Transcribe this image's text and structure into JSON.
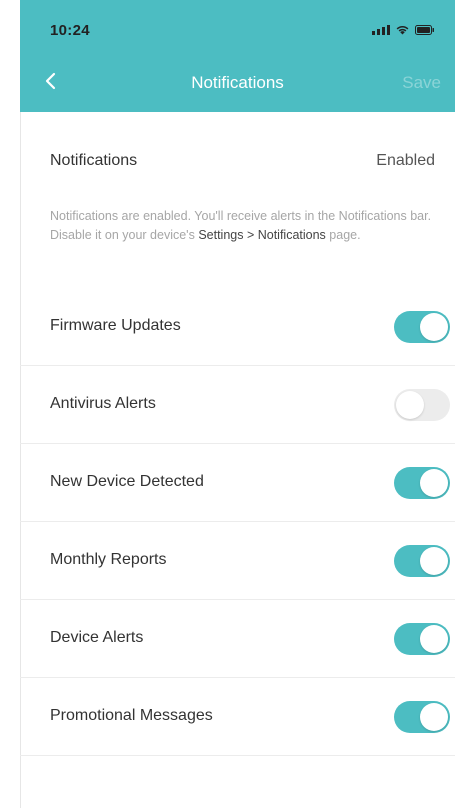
{
  "status_bar": {
    "time": "10:24"
  },
  "nav": {
    "title": "Notifications",
    "save_label": "Save"
  },
  "summary": {
    "label": "Notifications",
    "value": "Enabled"
  },
  "description": {
    "text": "Notifications are enabled. You'll receive alerts in the Notifications bar. Disable it on your device's",
    "path": "Settings > Notifications",
    "suffix": "page."
  },
  "items": [
    {
      "label": "Firmware Updates",
      "enabled": true
    },
    {
      "label": "Antivirus Alerts",
      "enabled": false
    },
    {
      "label": "New Device Detected",
      "enabled": true
    },
    {
      "label": "Monthly Reports",
      "enabled": true
    },
    {
      "label": "Device Alerts",
      "enabled": true
    },
    {
      "label": "Promotional Messages",
      "enabled": true
    }
  ],
  "colors": {
    "accent": "#4cbdc2",
    "toggle_off": "#ececec"
  }
}
